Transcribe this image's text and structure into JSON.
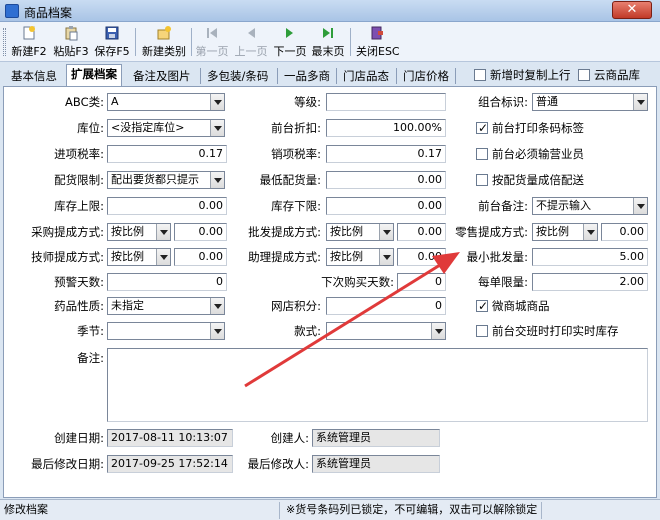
{
  "window": {
    "title": "商品档案",
    "close_label": "✕"
  },
  "toolbar": {
    "new": "新建F2",
    "paste": "粘贴F3",
    "save": "保存F5",
    "new_category": "新建类别",
    "first": "第一页",
    "prev": "上一页",
    "next": "下一页",
    "last": "最末页",
    "close": "关闭ESC"
  },
  "tabs": [
    "基本信息",
    "扩展档案",
    "备注及图片",
    "多包装/条码",
    "一品多商",
    "门店品态",
    "门店价格"
  ],
  "tab_options": {
    "copy_on_add": "新增时复制上行",
    "cloud_product": "云商品库"
  },
  "form": {
    "abc": {
      "label": "ABC类:",
      "value": "A"
    },
    "grade": {
      "label": "等级:",
      "value": ""
    },
    "combo_flag": {
      "label": "组合标识:",
      "value": "普通"
    },
    "location": {
      "label": "库位:",
      "value": "<没指定库位>"
    },
    "front_discount": {
      "label": "前台折扣:",
      "value": "100.00%"
    },
    "print_barcode": {
      "label": "前台打印条码标签",
      "checked": true
    },
    "input_tax": {
      "label": "进项税率:",
      "value": "0.17"
    },
    "output_tax": {
      "label": "销项税率:",
      "value": "0.17"
    },
    "must_salesman": {
      "label": "前台必须输营业员",
      "checked": false
    },
    "dist_limit": {
      "label": "配货限制:",
      "value": "配出要货都只提示"
    },
    "min_dist": {
      "label": "最低配货量:",
      "value": "0.00"
    },
    "multiple_dist": {
      "label": "按配货量成倍配送",
      "checked": false
    },
    "stock_max": {
      "label": "库存上限:",
      "value": "0.00"
    },
    "stock_min": {
      "label": "库存下限:",
      "value": "0.00"
    },
    "front_note": {
      "label": "前台备注:",
      "value": "不提示输入"
    },
    "purchase_comm": {
      "label": "采购提成方式:",
      "mode": "按比例",
      "value": "0.00"
    },
    "wholesale_comm": {
      "label": "批发提成方式:",
      "mode": "按比例",
      "value": "0.00"
    },
    "retail_comm": {
      "label": "零售提成方式:",
      "mode": "按比例",
      "value": "0.00"
    },
    "tech_comm": {
      "label": "技师提成方式:",
      "mode": "按比例",
      "value": "0.00"
    },
    "assist_comm": {
      "label": "助理提成方式:",
      "mode": "按比例",
      "value": "0.00"
    },
    "min_batch": {
      "label": "最小批发量:",
      "value": "5.00"
    },
    "warn_days": {
      "label": "预警天数:",
      "value": "0"
    },
    "next_buy_days": {
      "label": "下次购买天数:",
      "value": "0"
    },
    "order_limit": {
      "label": "每单限量:",
      "value": "2.00"
    },
    "drug_nature": {
      "label": "药品性质:",
      "value": "未指定"
    },
    "online_points": {
      "label": "网店积分:",
      "value": "0"
    },
    "wechat_mall": {
      "label": "微商城商品",
      "checked": true
    },
    "season": {
      "label": "季节:",
      "value": ""
    },
    "style": {
      "label": "款式:",
      "value": ""
    },
    "shift_print": {
      "label": "前台交班时打印实时库存",
      "checked": false
    },
    "remark": {
      "label": "备注:",
      "value": ""
    },
    "created_date": {
      "label": "创建日期:",
      "value": "2017-08-11 10:13:07"
    },
    "creator": {
      "label": "创建人:",
      "value": "系统管理员"
    },
    "modified_date": {
      "label": "最后修改日期:",
      "value": "2017-09-25 17:52:14"
    },
    "modifier": {
      "label": "最后修改人:",
      "value": "系统管理员"
    }
  },
  "status": {
    "left": "修改档案",
    "middle": "※货号条码列已锁定，不可编辑，双击可以解除锁定"
  },
  "colors": {
    "annotation_arrow": "#e03a3a",
    "accent": "#2f6fd2"
  }
}
